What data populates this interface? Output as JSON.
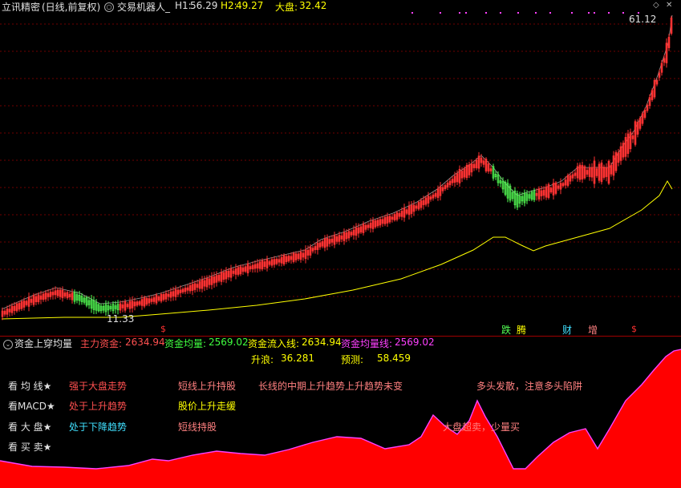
{
  "colors": {
    "bg": "#000000",
    "up": "#ff3232",
    "down": "#54ff54",
    "ma": "#ffff00",
    "grid": "#700000",
    "text_white": "#c0c0c0",
    "text_yellow": "#ffff00",
    "text_red": "#ff5050",
    "text_cyan": "#40e0ff",
    "text_magenta": "#ff40ff",
    "text_green": "#40ff40",
    "text_pink": "#ff8080"
  },
  "header": {
    "app_name": "立讯精密",
    "mode": "(日线,前复权)",
    "indicator": "交易机器人_",
    "h1_label": "H1:",
    "h1_value": "56.29",
    "h2_label": "H2:",
    "h2_value": "49.27",
    "market_label": "大盘:",
    "market_value": "32.42"
  },
  "main_chart": {
    "high_label": "61.12",
    "low_label": "11.33",
    "signal_markers": [
      "$",
      "$"
    ],
    "event_labels": [
      {
        "text": "跌",
        "color": "#54ff54"
      },
      {
        "text": "腾",
        "color": "#ffff00"
      },
      {
        "text": "财",
        "color": "#40e0ff"
      },
      {
        "text": "增",
        "color": "#ff8080"
      }
    ]
  },
  "indicator": {
    "title": "资金上穿均量",
    "items": [
      {
        "label": "主力资金:",
        "value": "2634.94"
      },
      {
        "label": "资金均量:",
        "value": "2569.02"
      },
      {
        "label": "资金流入线:",
        "value": "2634.94"
      },
      {
        "label": "资金均量线:",
        "value": "2569.02"
      }
    ],
    "rise_label": "升浪:",
    "rise_value": "36.281",
    "predict_label": "预测:",
    "predict_value": "58.459",
    "side_menu": [
      "看 均 线★",
      "看MACD★",
      "看 大 盘★",
      "看 买 卖★"
    ],
    "status": {
      "ma_trend": "强于大盘走势",
      "macd_trend": "处于上升趋势",
      "market_trend": "处于下降趋势",
      "short_up": "短线上升持股",
      "price_up": "股价上升走缓",
      "short_hold": "短线持股",
      "long_trend": "长线的中期上升趋势上升趋势未变",
      "bull": "多头发散，注意多头陷阱",
      "market_sell": "大盘超卖，少量买"
    }
  }
}
